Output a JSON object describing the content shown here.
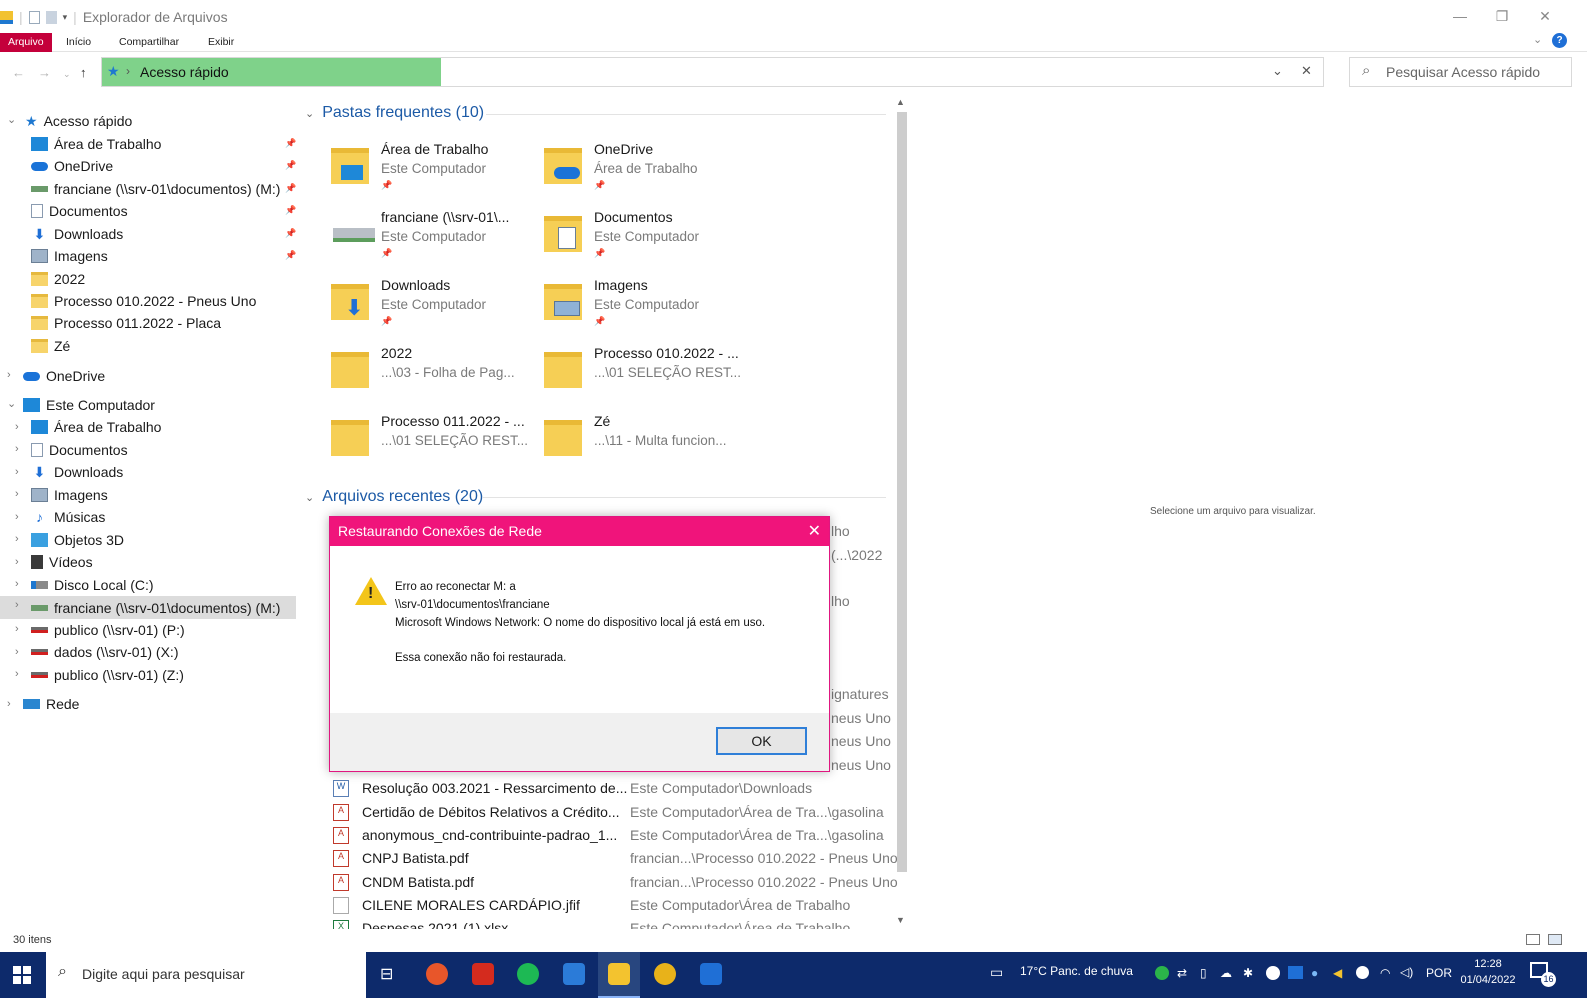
{
  "window": {
    "title": "Explorador de Arquivos",
    "controls": {
      "minimize": "—",
      "restore": "❐",
      "close": "✕"
    }
  },
  "ribbon": {
    "tabs": [
      {
        "label": "Arquivo",
        "active": true
      },
      {
        "label": "Início"
      },
      {
        "label": "Compartilhar"
      },
      {
        "label": "Exibir"
      }
    ],
    "help": "?"
  },
  "addressbar": {
    "path": "Acesso rápido",
    "search_placeholder": "Pesquisar Acesso rápido",
    "clear": "✕",
    "dropdown": "⌄"
  },
  "navpane": {
    "quick_access": {
      "label": "Acesso rápido",
      "items": [
        {
          "label": "Área de Trabalho",
          "icon": "desktop-icon",
          "pinned": true
        },
        {
          "label": "OneDrive",
          "icon": "cloud-icon",
          "pinned": true
        },
        {
          "label": "franciane (\\\\srv-01\\documentos) (M:)",
          "icon": "network-drive-icon",
          "pinned": true
        },
        {
          "label": "Documentos",
          "icon": "document-icon",
          "pinned": true
        },
        {
          "label": "Downloads",
          "icon": "download-icon",
          "pinned": true
        },
        {
          "label": "Imagens",
          "icon": "image-icon",
          "pinned": true
        },
        {
          "label": "2022",
          "icon": "folder-icon"
        },
        {
          "label": "Processo 010.2022 - Pneus Uno",
          "icon": "folder-icon"
        },
        {
          "label": "Processo 011.2022 - Placa",
          "icon": "folder-icon"
        },
        {
          "label": "Zé",
          "icon": "folder-icon"
        }
      ]
    },
    "onedrive": {
      "label": "OneDrive"
    },
    "this_pc": {
      "label": "Este Computador",
      "items": [
        {
          "label": "Área de Trabalho",
          "icon": "desktop-icon"
        },
        {
          "label": "Documentos",
          "icon": "document-icon"
        },
        {
          "label": "Downloads",
          "icon": "download-icon"
        },
        {
          "label": "Imagens",
          "icon": "image-icon"
        },
        {
          "label": "Músicas",
          "icon": "music-icon"
        },
        {
          "label": "Objetos 3D",
          "icon": "cube-icon"
        },
        {
          "label": "Vídeos",
          "icon": "video-icon"
        },
        {
          "label": "Disco Local (C:)",
          "icon": "disk-icon"
        },
        {
          "label": "franciane (\\\\srv-01\\documentos) (M:)",
          "icon": "network-drive-icon",
          "selected": true
        },
        {
          "label": "publico (\\\\srv-01) (P:)",
          "icon": "network-drive-disconnected-icon"
        },
        {
          "label": "dados (\\\\srv-01) (X:)",
          "icon": "network-drive-disconnected-icon"
        },
        {
          "label": "publico (\\\\srv-01) (Z:)",
          "icon": "network-drive-disconnected-icon"
        }
      ]
    },
    "network": {
      "label": "Rede"
    }
  },
  "content": {
    "frequent_header": "Pastas frequentes (10)",
    "frequent": [
      {
        "name": "Área de Trabalho",
        "sub": "Este Computador",
        "pinned": true
      },
      {
        "name": "OneDrive",
        "sub": "Área de Trabalho",
        "pinned": true
      },
      {
        "name": "franciane (\\\\srv-01\\...",
        "sub": "Este Computador",
        "pinned": true
      },
      {
        "name": "Documentos",
        "sub": "Este Computador",
        "pinned": true
      },
      {
        "name": "Downloads",
        "sub": "Este Computador",
        "pinned": true
      },
      {
        "name": "Imagens",
        "sub": "Este Computador",
        "pinned": true
      },
      {
        "name": "2022",
        "sub": "...\\03 - Folha de Pag..."
      },
      {
        "name": "Processo 010.2022 - ...",
        "sub": "...\\01 SELEÇÃO REST..."
      },
      {
        "name": "Processo 011.2022 - ...",
        "sub": "...\\01 SELEÇÃO REST..."
      },
      {
        "name": "Zé",
        "sub": "...\\11 - Multa funcion..."
      }
    ],
    "recent_header": "Arquivos recentes (20)",
    "partial_locations": [
      "lho",
      "(...\\2022",
      "lho",
      "ignatures",
      "neus Uno",
      "neus Uno",
      "neus Uno"
    ],
    "recent": [
      {
        "name": "Resolução 003.2021 - Ressarcimento de...",
        "location": "Este Computador\\Downloads",
        "type": "doc"
      },
      {
        "name": "Certidão de Débitos Relativos a Crédito...",
        "location": "Este Computador\\Área de Tra...\\gasolina",
        "type": "pdf"
      },
      {
        "name": "anonymous_cnd-contribuinte-padrao_1...",
        "location": "Este Computador\\Área de Tra...\\gasolina",
        "type": "pdf"
      },
      {
        "name": "CNPJ Batista.pdf",
        "location": "francian...\\Processo 010.2022 - Pneus Uno",
        "type": "pdf"
      },
      {
        "name": "CNDM Batista.pdf",
        "location": "francian...\\Processo 010.2022 - Pneus Uno",
        "type": "pdf"
      },
      {
        "name": "CILENE MORALES CARDÁPIO.jfif",
        "location": "Este Computador\\Área de Trabalho",
        "type": "img"
      },
      {
        "name": "Despesas 2021 (1).xlsx",
        "location": "Este Computador\\Área de Trabalho",
        "type": "xls"
      }
    ],
    "preview_text": "Selecione um arquivo para visualizar."
  },
  "status": {
    "items": "30 itens"
  },
  "dialog": {
    "title": "Restaurando Conexões de Rede",
    "close": "✕",
    "line1": "Erro ao reconectar M: a",
    "line2": "\\\\srv-01\\documentos\\franciane",
    "line3": "Microsoft Windows Network: O nome do dispositivo local já está em uso.",
    "line4": "Essa conexão não foi restaurada.",
    "ok": "OK",
    "warning_mark": "!"
  },
  "taskbar": {
    "search_placeholder": "Digite aqui para pesquisar",
    "weather": "17°C  Panc. de chuva",
    "lang": "POR",
    "time": "12:28",
    "date": "01/04/2022",
    "notif_count": "16",
    "colors": {
      "firefox": "#e8562a",
      "acrobat": "#d42b1e",
      "spotify": "#1db954",
      "calc": "#2b7bd8",
      "explorer": "#f3c32f",
      "chrome": "#e8b21a",
      "outlook": "#1f6fd6"
    }
  }
}
